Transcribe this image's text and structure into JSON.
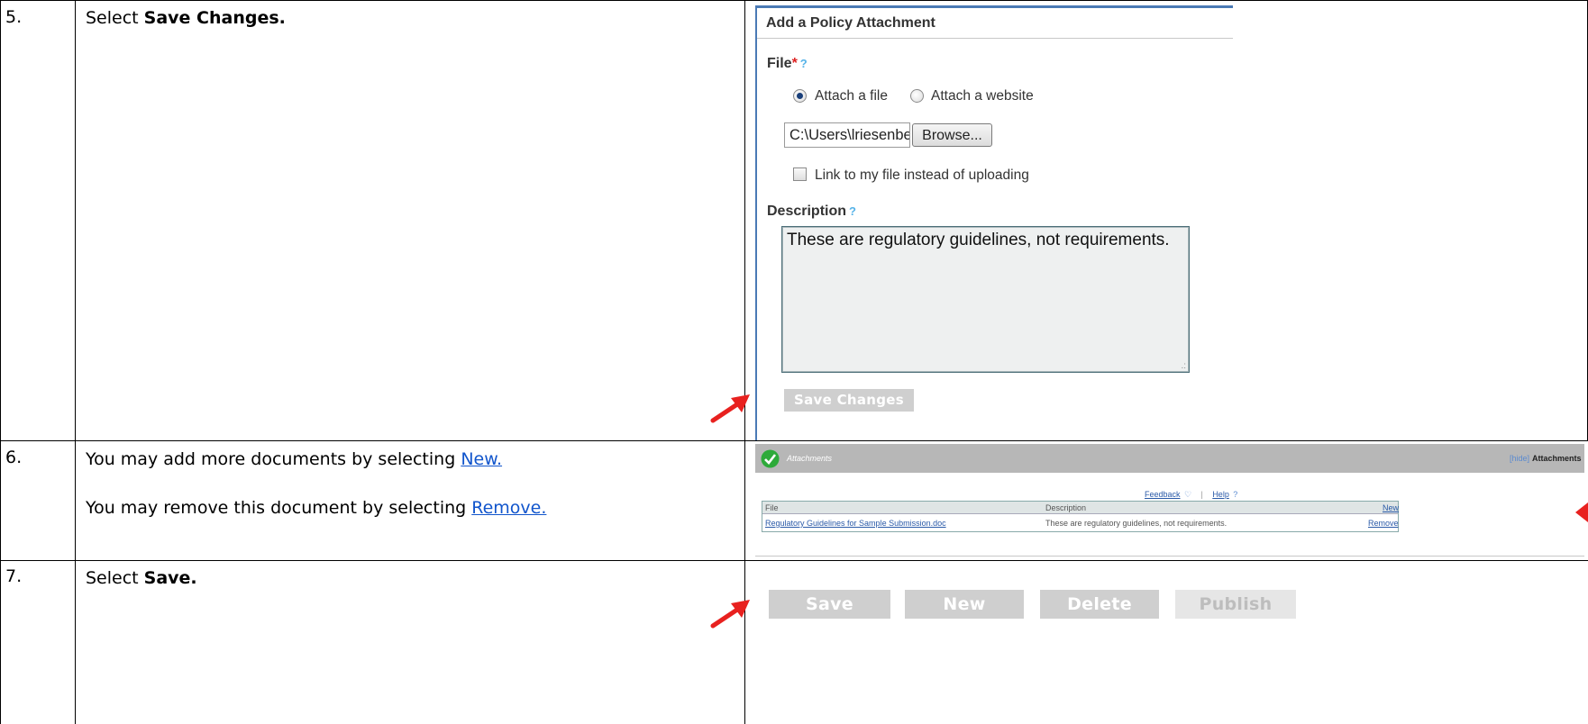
{
  "rows": [
    {
      "num": "5.",
      "text_prefix": "Select ",
      "text_bold": "Save Changes."
    },
    {
      "num": "6.",
      "line1_prefix": "You may add more documents by selecting ",
      "line1_link": "New.",
      "line2_prefix": "You may remove this document by selecting ",
      "line2_link": "Remove."
    },
    {
      "num": "7.",
      "text_prefix": "Select ",
      "text_bold": "Save."
    }
  ],
  "policy_dialog": {
    "title": "Add a Policy Attachment",
    "file_label": "File",
    "required_mark": "*",
    "help": "?",
    "radio_file": "Attach a file",
    "radio_site": "Attach a website",
    "file_path": "C:\\Users\\lriesenberg\\D",
    "browse": "Browse...",
    "link_checkbox": "Link to my file instead of uploading",
    "description_label": "Description",
    "description_value": "These are regulatory guidelines, not requirements.",
    "save_changes": "Save Changes"
  },
  "attachments": {
    "header_title": "Attachments",
    "hide": "[hide]",
    "right_title": "Attachments",
    "feedback": "Feedback",
    "help": "Help",
    "col_file": "File",
    "col_description": "Description",
    "col_new": "New",
    "file_name": "Regulatory Guidelines for Sample Submission.doc",
    "description": "These are regulatory guidelines, not requirements.",
    "remove": "Remove"
  },
  "toolbar": {
    "save": "Save",
    "new": "New",
    "delete": "Delete",
    "publish": "Publish"
  },
  "colors": {
    "arrow": "#e8211f",
    "check": "#2eaa3a",
    "dialog_border": "#4a7ab5"
  }
}
